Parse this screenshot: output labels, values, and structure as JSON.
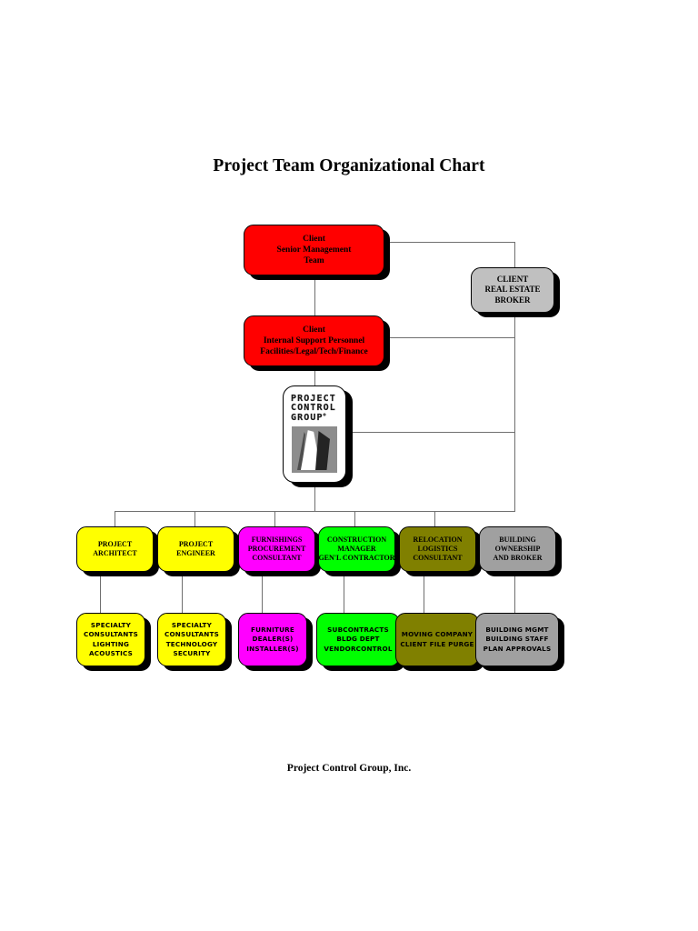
{
  "page": {
    "title": "Project Team Organizational Chart",
    "footer": "Project Control Group, Inc."
  },
  "colors": {
    "red": "#FF0000",
    "yellow": "#FFFF00",
    "magenta": "#FF00FF",
    "green": "#00FF00",
    "olive": "#808000",
    "gray": "#A0A0A0",
    "broker_gray": "#C0C0C0",
    "shadow": "#000000",
    "line": "#6F6F6F",
    "white": "#FFFFFF"
  },
  "chart_data": {
    "type": "diagram",
    "title": "Project Team Organizational Chart",
    "nodes": [
      {
        "id": "client-senior-management",
        "lines": [
          "Client",
          "Senior Management",
          "Team"
        ],
        "color": "#FF0000",
        "level": 0
      },
      {
        "id": "client-internal-support",
        "lines": [
          "Client",
          "Internal Support Personnel",
          "Facilities/Legal/Tech/Finance"
        ],
        "color": "#FF0000",
        "level": 1
      },
      {
        "id": "client-real-estate-broker",
        "lines": [
          "CLIENT",
          "REAL ESTATE",
          "BROKER"
        ],
        "color": "#C0C0C0",
        "level": 1
      },
      {
        "id": "project-control-group",
        "lines": [
          "PROJECT",
          "CONTROL",
          "GROUP"
        ],
        "color": "#FFFFFF",
        "level": 2
      }
    ],
    "tier1": [
      {
        "id": "project-architect",
        "lines": [
          "PROJECT",
          "ARCHITECT"
        ],
        "color": "#FFFF00"
      },
      {
        "id": "project-engineer",
        "lines": [
          "PROJECT",
          "ENGINEER"
        ],
        "color": "#FFFF00"
      },
      {
        "id": "furnishings-procurement-consultant",
        "lines": [
          "FURNISHINGS",
          "PROCUREMENT",
          "CONSULTANT"
        ],
        "color": "#FF00FF"
      },
      {
        "id": "construction-manager",
        "lines": [
          "CONSTRUCTION",
          "MANAGER",
          "GEN'L CONTRACTOR"
        ],
        "color": "#00FF00"
      },
      {
        "id": "relocation-logistics-consultant",
        "lines": [
          "RELOCATION",
          "LOGISTICS",
          "CONSULTANT"
        ],
        "color": "#808000"
      },
      {
        "id": "building-ownership-and-broker",
        "lines": [
          "BUILDING",
          "OWNERSHIP",
          "AND BROKER"
        ],
        "color": "#A0A0A0"
      }
    ],
    "tier2": [
      {
        "id": "specialty-consultants-lighting",
        "lines": [
          "SPECIALTY",
          "CONSULTANTS",
          "LIGHTING",
          "ACOUSTICS"
        ],
        "color": "#FFFF00"
      },
      {
        "id": "specialty-consultants-technology",
        "lines": [
          "SPECIALTY",
          "CONSULTANTS",
          "TECHNOLOGY",
          "SECURITY"
        ],
        "color": "#FFFF00"
      },
      {
        "id": "furniture-dealers-installers",
        "lines": [
          "FURNITURE",
          "DEALER(S)",
          "INSTALLER(S)"
        ],
        "color": "#FF00FF"
      },
      {
        "id": "subcontracts-bldg-dept",
        "lines": [
          "SUBCONTRACTS",
          "BLDG DEPT",
          "VENDORCONTROL"
        ],
        "color": "#00FF00"
      },
      {
        "id": "moving-company-client-file-purge",
        "lines": [
          "MOVING COMPANY",
          "CLIENT FILE PURGE"
        ],
        "color": "#808000"
      },
      {
        "id": "building-mgmt-staff-approvals",
        "lines": [
          "BUILDING MGMT",
          "BUILDING STAFF",
          "PLAN APPROVALS"
        ],
        "color": "#A0A0A0"
      }
    ],
    "logo": {
      "word1": "PROJECT",
      "word2": "CONTROL",
      "word3": "GROUP",
      "superscript": "®"
    }
  }
}
